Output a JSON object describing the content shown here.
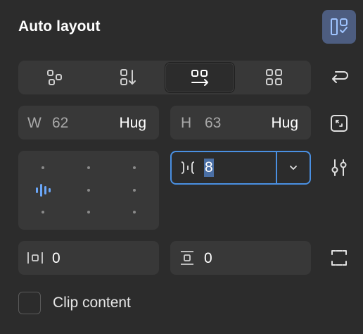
{
  "panel": {
    "title": "Auto layout"
  },
  "direction": {
    "options": [
      "freeform",
      "vertical",
      "horizontal",
      "wrap"
    ],
    "selected": "horizontal"
  },
  "size": {
    "width_label": "W",
    "width_value": "62",
    "width_mode": "Hug",
    "height_label": "H",
    "height_value": "63",
    "height_mode": "Hug"
  },
  "gap": {
    "value": "8"
  },
  "padding": {
    "horizontal": "0",
    "vertical": "0"
  },
  "clip": {
    "label": "Clip content",
    "checked": false
  },
  "colors": {
    "background": "#2c2c2c",
    "field": "#383838",
    "accent": "#4a90e2",
    "toggle_active": "#4d5d80"
  },
  "icons": [
    "layout-toggle-icon",
    "freeform-icon",
    "vertical-layout-icon",
    "horizontal-layout-icon",
    "wrap-grid-icon",
    "wrap-icon",
    "resize-icon",
    "settings-sliders-icon",
    "gap-icon",
    "chevron-down-icon",
    "horizontal-padding-icon",
    "vertical-padding-icon",
    "clip-frame-icon"
  ]
}
